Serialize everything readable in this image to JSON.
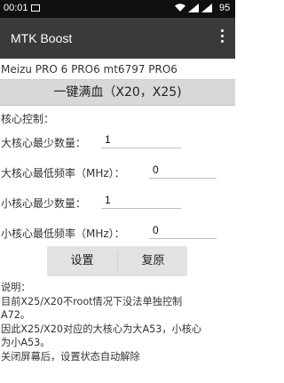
{
  "status_bar": {
    "time": "00:01",
    "battery": "95"
  },
  "app_bar": {
    "title": "MTK Boost"
  },
  "device_line": "Meizu PRO 6 PRO6 mt6797 PRO6",
  "max_button_label": "一键满血（X20，X25)",
  "section_label": "核心控制：",
  "settings": [
    {
      "label": "大核心最少数量：",
      "value": "1"
    },
    {
      "label": "大核心最低频率（MHz）：",
      "value": "0"
    },
    {
      "label": "小核心最少数量：",
      "value": "1"
    },
    {
      "label": "小核心最低频率（MHz）：",
      "value": "0"
    }
  ],
  "buttons": {
    "set": "设置",
    "reset": "复原"
  },
  "notes": {
    "title": "说明：",
    "lines": [
      "目前X25/X20不root情况下没法单独控制",
      "A72。",
      "因此X25/X20对应的大核心为大A53，小核心",
      "为小A53。",
      "关闭屏幕后，设置状态自动解除"
    ]
  },
  "colors": {
    "app_bar": "#3a3a3a",
    "status_bar": "#101010",
    "button_bg": "#d8d8d8"
  }
}
